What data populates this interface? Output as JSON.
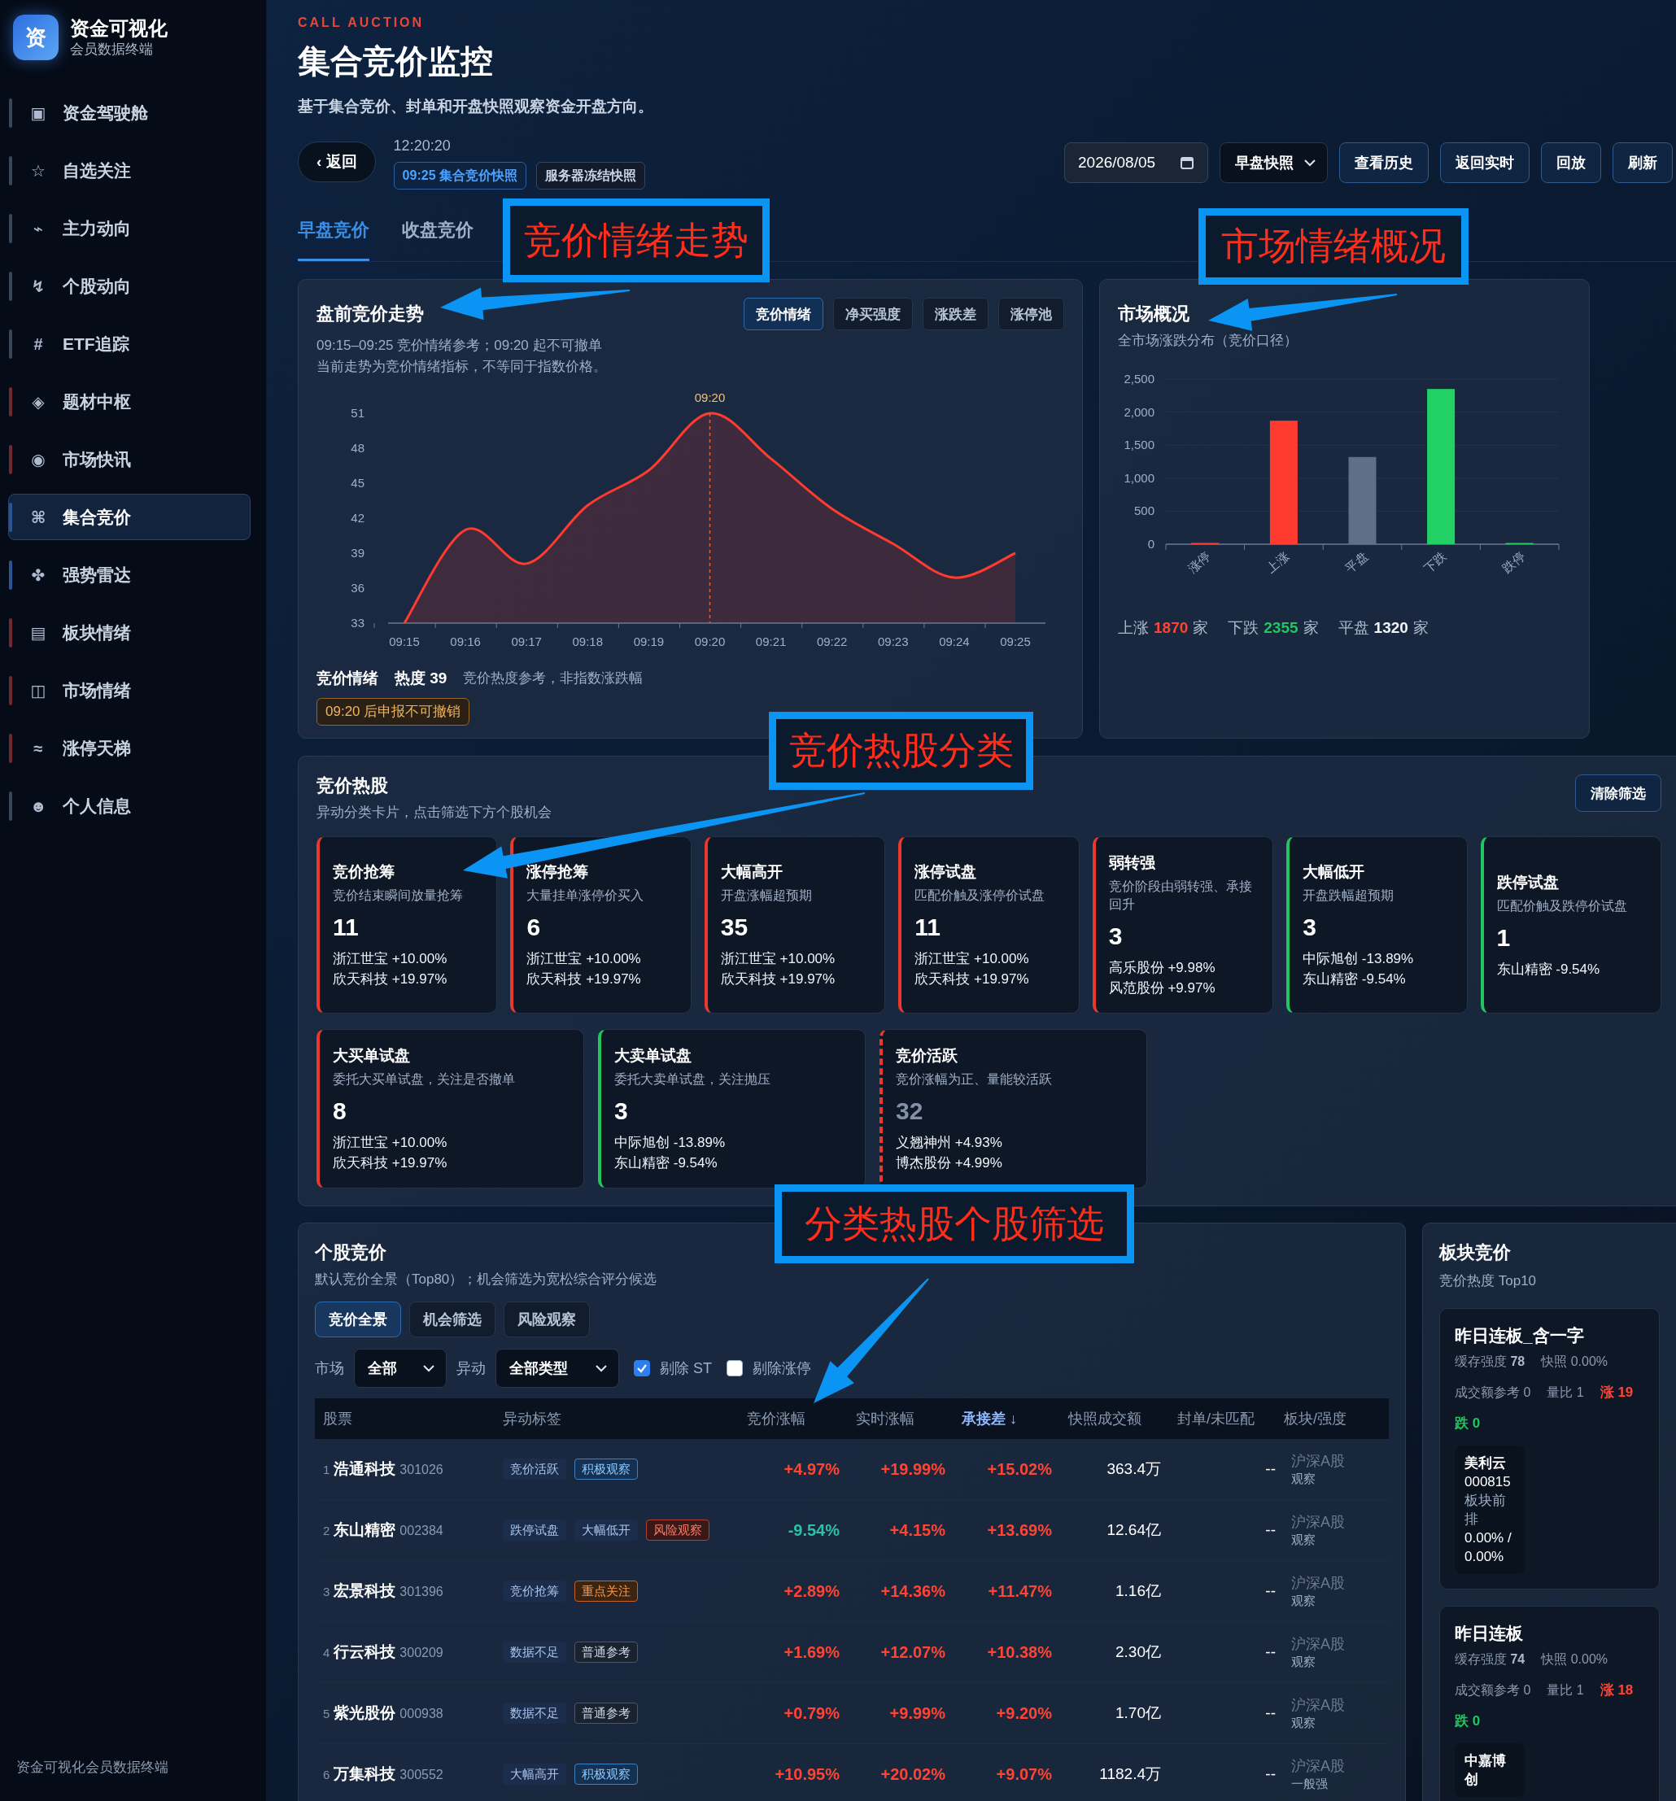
{
  "sidebar": {
    "logo": "资",
    "title": "资金可视化",
    "subtitle": "会员数据终端",
    "items": [
      {
        "icon": "▣",
        "label": "资金驾驶舱",
        "color": "#3a4759",
        "selected": false
      },
      {
        "icon": "☆",
        "label": "自选关注",
        "color": "#3a4759",
        "selected": false
      },
      {
        "icon": "⌁",
        "label": "主力动向",
        "color": "#3a4759",
        "selected": false
      },
      {
        "icon": "↯",
        "label": "个股动向",
        "color": "#3a4759",
        "selected": false
      },
      {
        "icon": "#",
        "label": "ETF追踪",
        "color": "#3a4759",
        "selected": false
      },
      {
        "icon": "◈",
        "label": "题材中枢",
        "color": "#6e2a30",
        "selected": false
      },
      {
        "icon": "◉",
        "label": "市场快讯",
        "color": "#6e2a30",
        "selected": false
      },
      {
        "icon": "⌘",
        "label": "集合竞价",
        "color": "#2c558f",
        "selected": true
      },
      {
        "icon": "✤",
        "label": "强势雷达",
        "color": "#2c558f",
        "selected": false
      },
      {
        "icon": "▤",
        "label": "板块情绪",
        "color": "#6e2a30",
        "selected": false
      },
      {
        "icon": "◫",
        "label": "市场情绪",
        "color": "#6e2a30",
        "selected": false
      },
      {
        "icon": "≈",
        "label": "涨停天梯",
        "color": "#6e2a30",
        "selected": false
      },
      {
        "icon": "☻",
        "label": "个人信息",
        "color": "#3a4759",
        "selected": false
      }
    ],
    "footer": "资金可视化会员数据终端"
  },
  "header": {
    "eyebrow": "CALL AUCTION",
    "title": "集合竞价监控",
    "subtitle": "基于集合竞价、封单和开盘快照观察资金开盘方向。",
    "back_button": "‹ 返回",
    "time": "12:20:20",
    "chips": [
      {
        "text": "09:25 集合竞价快照",
        "selected": true
      },
      {
        "text": "服务器冻结快照",
        "selected": false
      }
    ],
    "date_field": {
      "value": "2026/08/05"
    },
    "snapshot_select": {
      "value": "早盘快照"
    },
    "buttons": [
      "查看历史",
      "返回实时",
      "回放",
      "刷新"
    ]
  },
  "tabs": [
    {
      "label": "早盘竞价",
      "selected": true
    },
    {
      "label": "收盘竞价",
      "selected": false
    }
  ],
  "trend_card": {
    "title": "盘前竞价走势",
    "notes": [
      "09:15–09:25 竞价情绪参考；09:20 起不可撤单",
      "当前走势为竞价情绪指标，不等同于指数价格。"
    ],
    "tabs": [
      {
        "label": "竞价情绪",
        "selected": true
      },
      {
        "label": "净买强度",
        "selected": false
      },
      {
        "label": "涨跌差",
        "selected": false
      },
      {
        "label": "涨停池",
        "selected": false
      }
    ],
    "chart_data": {
      "type": "area",
      "categories": [
        "09:15",
        "09:16",
        "09:17",
        "09:18",
        "09:19",
        "09:20",
        "09:21",
        "09:22",
        "09:23",
        "09:24",
        "09:25"
      ],
      "series": [
        {
          "color": "#ff3b2f",
          "values": [
            33,
            41,
            38.1,
            43.1,
            46.1,
            51,
            47.1,
            42.8,
            39.8,
            36.9,
            39
          ]
        }
      ],
      "ylim": [
        33,
        51
      ],
      "yticks": [
        33,
        36,
        39,
        42,
        45,
        48,
        51
      ],
      "annotations": [
        {
          "x": "09:20",
          "text": "09:20"
        }
      ]
    },
    "footer": {
      "label": "竞价情绪",
      "heat": "热度 39",
      "note": "竞价热度参考，非指数涨跌幅",
      "badge": "09:20 后申报不可撤销"
    }
  },
  "market_card": {
    "title": "市场概况",
    "subtitle": "全市场涨跌分布（竞价口径）",
    "chart_data": {
      "type": "bar",
      "categories": [
        "涨停",
        "上涨",
        "平盘",
        "下跌",
        "跌停"
      ],
      "stacked": true,
      "grid": true,
      "series": [
        {
          "color": "#ff3b30",
          "values": [
            20,
            1870,
            null,
            null,
            null
          ]
        },
        {
          "color": "#5f6f87",
          "values": [
            null,
            null,
            1320,
            null,
            null
          ]
        },
        {
          "color": "#22d163",
          "values": [
            null,
            null,
            null,
            2350,
            10
          ]
        }
      ],
      "ylim": [
        0,
        2500
      ],
      "yticks": [
        {
          "value": 0,
          "label": "0"
        },
        {
          "value": 500,
          "label": "500"
        },
        {
          "value": 1000,
          "label": "1,000"
        },
        {
          "value": 1500,
          "label": "1,500"
        },
        {
          "value": 2000,
          "label": "2,000"
        },
        {
          "value": 2500,
          "label": "2,500"
        }
      ]
    },
    "summary": [
      {
        "label": "上涨",
        "value": "1870",
        "unit": "家",
        "color": "#ff4433"
      },
      {
        "label": "下跌",
        "value": "2355",
        "unit": "家",
        "color": "#22c55e"
      },
      {
        "label": "平盘",
        "value": "1320",
        "unit": "家",
        "color": "#f1f5fa"
      }
    ]
  },
  "hot_panel": {
    "title": "竞价热股",
    "subtitle": "异动分类卡片，点击筛选下方个股机会",
    "clear_button": "清除筛选",
    "cards": [
      {
        "title": "竞价抢筹",
        "description": "竞价结束瞬间放量抢筹",
        "count": "11",
        "stocks": [
          "浙江世宝 +10.00%",
          "欣天科技 +19.97%"
        ],
        "color": "#e8392e",
        "kind": "solid"
      },
      {
        "title": "涨停抢筹",
        "description": "大量挂单涨停价买入",
        "count": "6",
        "stocks": [
          "浙江世宝 +10.00%",
          "欣天科技 +19.97%"
        ],
        "color": "#e8392e",
        "kind": "solid"
      },
      {
        "title": "大幅高开",
        "description": "开盘涨幅超预期",
        "count": "35",
        "stocks": [
          "浙江世宝 +10.00%",
          "欣天科技 +19.97%"
        ],
        "color": "#e8392e",
        "kind": "solid"
      },
      {
        "title": "涨停试盘",
        "description": "匹配价触及涨停价试盘",
        "count": "11",
        "stocks": [
          "浙江世宝 +10.00%",
          "欣天科技 +19.97%"
        ],
        "color": "#e8392e",
        "kind": "solid"
      },
      {
        "title": "弱转强",
        "description": "竞价阶段由弱转强、承接回升",
        "count": "3",
        "stocks": [
          "高乐股份 +9.98%",
          "风范股份 +9.97%"
        ],
        "color": "#e8392e",
        "kind": "solid"
      },
      {
        "title": "大幅低开",
        "description": "开盘跌幅超预期",
        "count": "3",
        "stocks": [
          "中际旭创 -13.89%",
          "东山精密 -9.54%"
        ],
        "color": "#22c55e",
        "kind": "solid"
      },
      {
        "title": "跌停试盘",
        "description": "匹配价触及跌停价试盘",
        "count": "1",
        "stocks": [
          "东山精密 -9.54%"
        ],
        "color": "#22c55e",
        "kind": "solid"
      },
      {
        "title": "大买单试盘",
        "description": "委托大买单试盘，关注是否撤单",
        "count": "8",
        "stocks": [
          "浙江世宝 +10.00%",
          "欣天科技 +19.97%"
        ],
        "color": "#e8392e",
        "kind": "solid"
      },
      {
        "title": "大卖单试盘",
        "description": "委托大卖单试盘，关注抛压",
        "count": "3",
        "stocks": [
          "中际旭创 -13.89%",
          "东山精密 -9.54%"
        ],
        "color": "#22c55e",
        "kind": "solid"
      },
      {
        "title": "竞价活跃",
        "description": "竞价涨幅为正、量能较活跃",
        "count": "32",
        "stocks": [
          "义翘神州 +4.93%",
          "博杰股份 +4.99%"
        ],
        "color": "#e8392e",
        "kind": "dashed"
      }
    ]
  },
  "stocks_panel": {
    "title": "个股竞价",
    "subtitle": "默认竞价全景（Top80）；机会筛选为宽松综合评分候选",
    "segments": [
      {
        "label": "竞价全景",
        "selected": true
      },
      {
        "label": "机会筛选",
        "selected": false
      },
      {
        "label": "风险观察",
        "selected": false
      }
    ],
    "filters": {
      "market_label": "市场",
      "market_select": "全部",
      "type_label": "异动",
      "type_select": "全部类型",
      "checkboxes": [
        {
          "label": "剔除 ST",
          "checked": true
        },
        {
          "label": "剔除涨停",
          "checked": false
        }
      ]
    },
    "columns": [
      {
        "label": "股票",
        "sorted": false
      },
      {
        "label": "异动标签",
        "sorted": false
      },
      {
        "label": "竞价涨幅",
        "sorted": false
      },
      {
        "label": "实时涨幅",
        "sorted": false
      },
      {
        "label": "承接差 ↓",
        "sorted": true
      },
      {
        "label": "快照成交额",
        "sorted": false
      },
      {
        "label": "封单/未匹配",
        "sorted": false
      },
      {
        "label": "板块/强度",
        "sorted": false
      }
    ],
    "rows": [
      {
        "index": "1",
        "name": "浩通科技",
        "code": "301026",
        "tags": [
          {
            "text": "竞价活跃",
            "kind": "signal"
          },
          {
            "text": "积极观察",
            "kind": "positive"
          }
        ],
        "auction_change": {
          "text": "+4.97%",
          "color": "#ff4433"
        },
        "realtime_change": {
          "text": "+19.99%",
          "color": "#ff4433"
        },
        "spread": {
          "text": "+15.02%",
          "color": "#ff4433"
        },
        "amount": "363.4万",
        "seal": "--",
        "sector": "沪深A股",
        "strength": "观察"
      },
      {
        "index": "2",
        "name": "东山精密",
        "code": "002384",
        "tags": [
          {
            "text": "跌停试盘",
            "kind": "signal"
          },
          {
            "text": "大幅低开",
            "kind": "signal"
          },
          {
            "text": "风险观察",
            "kind": "risk"
          }
        ],
        "auction_change": {
          "text": "-9.54%",
          "color": "#2bc0a8"
        },
        "realtime_change": {
          "text": "+4.15%",
          "color": "#ff4433"
        },
        "spread": {
          "text": "+13.69%",
          "color": "#ff4433"
        },
        "amount": "12.64亿",
        "seal": "--",
        "sector": "沪深A股",
        "strength": "观察"
      },
      {
        "index": "3",
        "name": "宏景科技",
        "code": "301396",
        "tags": [
          {
            "text": "竞价抢筹",
            "kind": "signal"
          },
          {
            "text": "重点关注",
            "kind": "focus"
          }
        ],
        "auction_change": {
          "text": "+2.89%",
          "color": "#ff4433"
        },
        "realtime_change": {
          "text": "+14.36%",
          "color": "#ff4433"
        },
        "spread": {
          "text": "+11.47%",
          "color": "#ff4433"
        },
        "amount": "1.16亿",
        "seal": "--",
        "sector": "沪深A股",
        "strength": "观察"
      },
      {
        "index": "4",
        "name": "行云科技",
        "code": "300209",
        "tags": [
          {
            "text": "数据不足",
            "kind": "signal"
          },
          {
            "text": "普通参考",
            "kind": "plain"
          }
        ],
        "auction_change": {
          "text": "+1.69%",
          "color": "#ff4433"
        },
        "realtime_change": {
          "text": "+12.07%",
          "color": "#ff4433"
        },
        "spread": {
          "text": "+10.38%",
          "color": "#ff4433"
        },
        "amount": "2.30亿",
        "seal": "--",
        "sector": "沪深A股",
        "strength": "观察"
      },
      {
        "index": "5",
        "name": "紫光股份",
        "code": "000938",
        "tags": [
          {
            "text": "数据不足",
            "kind": "signal"
          },
          {
            "text": "普通参考",
            "kind": "plain"
          }
        ],
        "auction_change": {
          "text": "+0.79%",
          "color": "#ff4433"
        },
        "realtime_change": {
          "text": "+9.99%",
          "color": "#ff4433"
        },
        "spread": {
          "text": "+9.20%",
          "color": "#ff4433"
        },
        "amount": "1.70亿",
        "seal": "--",
        "sector": "沪深A股",
        "strength": "观察"
      },
      {
        "index": "6",
        "name": "万集科技",
        "code": "300552",
        "tags": [
          {
            "text": "大幅高开",
            "kind": "signal"
          },
          {
            "text": "积极观察",
            "kind": "positive"
          }
        ],
        "auction_change": {
          "text": "+10.95%",
          "color": "#ff4433"
        },
        "realtime_change": {
          "text": "+20.02%",
          "color": "#ff4433"
        },
        "spread": {
          "text": "+9.07%",
          "color": "#ff4433"
        },
        "amount": "1182.4万",
        "seal": "--",
        "sector": "沪深A股",
        "strength": "一般强"
      }
    ]
  },
  "sector_panel": {
    "title": "板块竞价",
    "subtitle": "竞价热度 Top10",
    "cards": [
      {
        "name": "昨日连板_含一字",
        "stats": [
          {
            "text": "缓存强度 **78**",
            "kind": "plain"
          },
          {
            "text": "快照 0.00%",
            "kind": "plain"
          },
          {
            "text": "成交额参考 0",
            "kind": "plain"
          },
          {
            "text": "量比 1",
            "kind": "plain"
          },
          {
            "text": "涨 19",
            "kind": "up"
          },
          {
            "text": "跌 0",
            "kind": "down"
          }
        ],
        "stocks": [
          {
            "name": "美利云",
            "code": "000815",
            "label": "板块前排",
            "value": "0.00% / 0.00%"
          }
        ]
      },
      {
        "name": "昨日连板",
        "stats": [
          {
            "text": "缓存强度 **74**",
            "kind": "plain"
          },
          {
            "text": "快照 0.00%",
            "kind": "plain"
          },
          {
            "text": "成交额参考 0",
            "kind": "plain"
          },
          {
            "text": "量比 1",
            "kind": "plain"
          },
          {
            "text": "涨 18",
            "kind": "up"
          },
          {
            "text": "跌 0",
            "kind": "down"
          }
        ],
        "stocks": [
          {
            "name": "中嘉博创"
          }
        ]
      }
    ]
  },
  "annotations": [
    {
      "text": "竞价情绪走势"
    },
    {
      "text": "市场情绪概况"
    },
    {
      "text": "竞价热股分类"
    },
    {
      "text": "分类热股个股筛选"
    }
  ]
}
